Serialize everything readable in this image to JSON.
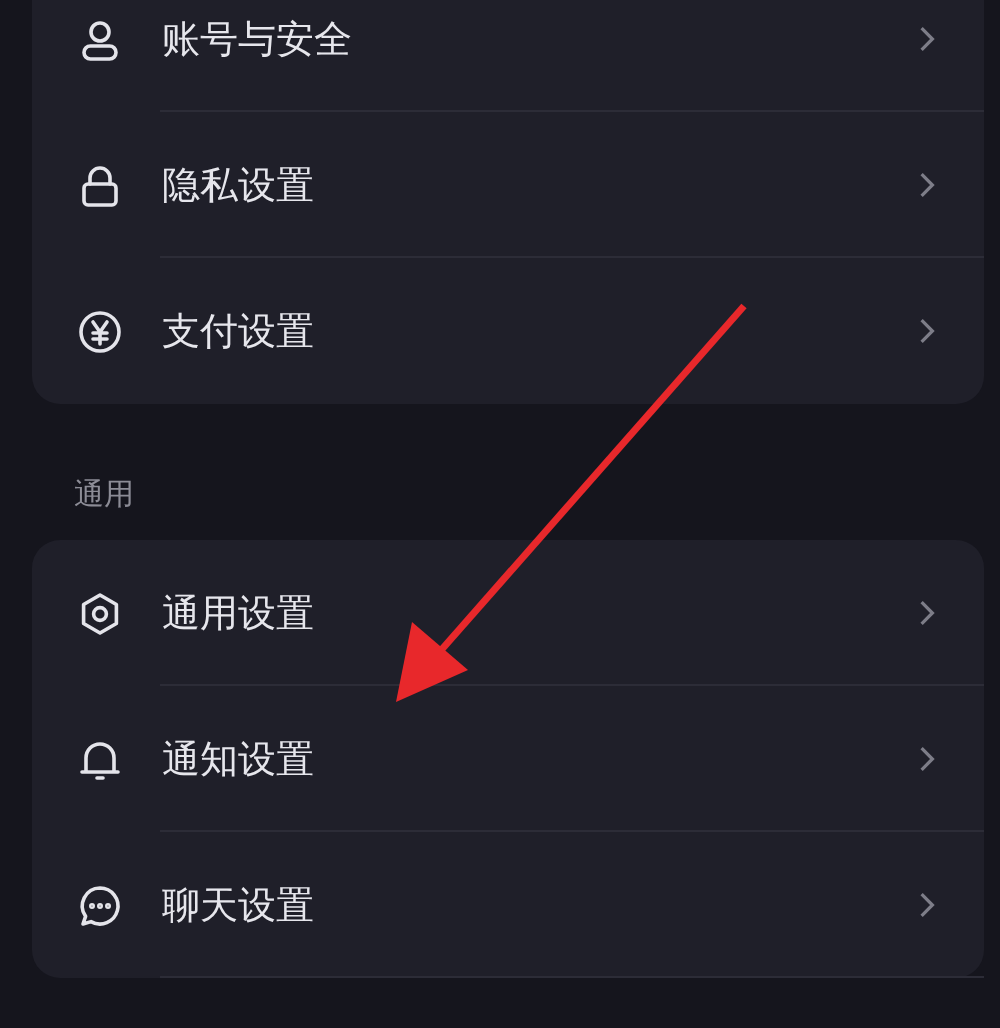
{
  "groups": [
    {
      "items": [
        {
          "kind": "person",
          "label": "账号与安全"
        },
        {
          "kind": "lock",
          "label": "隐私设置"
        },
        {
          "kind": "yen",
          "label": "支付设置"
        }
      ]
    },
    {
      "title": "通用",
      "items": [
        {
          "kind": "gear",
          "label": "通用设置"
        },
        {
          "kind": "bell",
          "label": "通知设置"
        },
        {
          "kind": "chat",
          "label": "聊天设置"
        }
      ]
    }
  ],
  "annotation": {
    "kind": "arrow"
  }
}
